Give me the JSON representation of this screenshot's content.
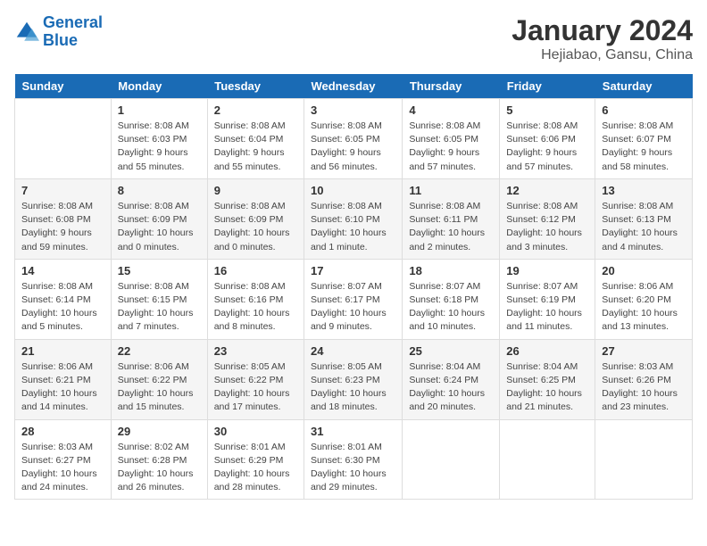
{
  "logo": {
    "line1": "General",
    "line2": "Blue"
  },
  "header": {
    "month": "January 2024",
    "location": "Hejiabao, Gansu, China"
  },
  "weekdays": [
    "Sunday",
    "Monday",
    "Tuesday",
    "Wednesday",
    "Thursday",
    "Friday",
    "Saturday"
  ],
  "weeks": [
    [
      null,
      {
        "day": 1,
        "sunrise": "8:08 AM",
        "sunset": "6:03 PM",
        "daylight": "9 hours and 55 minutes."
      },
      {
        "day": 2,
        "sunrise": "8:08 AM",
        "sunset": "6:04 PM",
        "daylight": "9 hours and 55 minutes."
      },
      {
        "day": 3,
        "sunrise": "8:08 AM",
        "sunset": "6:05 PM",
        "daylight": "9 hours and 56 minutes."
      },
      {
        "day": 4,
        "sunrise": "8:08 AM",
        "sunset": "6:05 PM",
        "daylight": "9 hours and 57 minutes."
      },
      {
        "day": 5,
        "sunrise": "8:08 AM",
        "sunset": "6:06 PM",
        "daylight": "9 hours and 57 minutes."
      },
      {
        "day": 6,
        "sunrise": "8:08 AM",
        "sunset": "6:07 PM",
        "daylight": "9 hours and 58 minutes."
      }
    ],
    [
      {
        "day": 7,
        "sunrise": "8:08 AM",
        "sunset": "6:08 PM",
        "daylight": "9 hours and 59 minutes."
      },
      {
        "day": 8,
        "sunrise": "8:08 AM",
        "sunset": "6:09 PM",
        "daylight": "10 hours and 0 minutes."
      },
      {
        "day": 9,
        "sunrise": "8:08 AM",
        "sunset": "6:09 PM",
        "daylight": "10 hours and 0 minutes."
      },
      {
        "day": 10,
        "sunrise": "8:08 AM",
        "sunset": "6:10 PM",
        "daylight": "10 hours and 1 minute."
      },
      {
        "day": 11,
        "sunrise": "8:08 AM",
        "sunset": "6:11 PM",
        "daylight": "10 hours and 2 minutes."
      },
      {
        "day": 12,
        "sunrise": "8:08 AM",
        "sunset": "6:12 PM",
        "daylight": "10 hours and 3 minutes."
      },
      {
        "day": 13,
        "sunrise": "8:08 AM",
        "sunset": "6:13 PM",
        "daylight": "10 hours and 4 minutes."
      }
    ],
    [
      {
        "day": 14,
        "sunrise": "8:08 AM",
        "sunset": "6:14 PM",
        "daylight": "10 hours and 5 minutes."
      },
      {
        "day": 15,
        "sunrise": "8:08 AM",
        "sunset": "6:15 PM",
        "daylight": "10 hours and 7 minutes."
      },
      {
        "day": 16,
        "sunrise": "8:08 AM",
        "sunset": "6:16 PM",
        "daylight": "10 hours and 8 minutes."
      },
      {
        "day": 17,
        "sunrise": "8:07 AM",
        "sunset": "6:17 PM",
        "daylight": "10 hours and 9 minutes."
      },
      {
        "day": 18,
        "sunrise": "8:07 AM",
        "sunset": "6:18 PM",
        "daylight": "10 hours and 10 minutes."
      },
      {
        "day": 19,
        "sunrise": "8:07 AM",
        "sunset": "6:19 PM",
        "daylight": "10 hours and 11 minutes."
      },
      {
        "day": 20,
        "sunrise": "8:06 AM",
        "sunset": "6:20 PM",
        "daylight": "10 hours and 13 minutes."
      }
    ],
    [
      {
        "day": 21,
        "sunrise": "8:06 AM",
        "sunset": "6:21 PM",
        "daylight": "10 hours and 14 minutes."
      },
      {
        "day": 22,
        "sunrise": "8:06 AM",
        "sunset": "6:22 PM",
        "daylight": "10 hours and 15 minutes."
      },
      {
        "day": 23,
        "sunrise": "8:05 AM",
        "sunset": "6:22 PM",
        "daylight": "10 hours and 17 minutes."
      },
      {
        "day": 24,
        "sunrise": "8:05 AM",
        "sunset": "6:23 PM",
        "daylight": "10 hours and 18 minutes."
      },
      {
        "day": 25,
        "sunrise": "8:04 AM",
        "sunset": "6:24 PM",
        "daylight": "10 hours and 20 minutes."
      },
      {
        "day": 26,
        "sunrise": "8:04 AM",
        "sunset": "6:25 PM",
        "daylight": "10 hours and 21 minutes."
      },
      {
        "day": 27,
        "sunrise": "8:03 AM",
        "sunset": "6:26 PM",
        "daylight": "10 hours and 23 minutes."
      }
    ],
    [
      {
        "day": 28,
        "sunrise": "8:03 AM",
        "sunset": "6:27 PM",
        "daylight": "10 hours and 24 minutes."
      },
      {
        "day": 29,
        "sunrise": "8:02 AM",
        "sunset": "6:28 PM",
        "daylight": "10 hours and 26 minutes."
      },
      {
        "day": 30,
        "sunrise": "8:01 AM",
        "sunset": "6:29 PM",
        "daylight": "10 hours and 28 minutes."
      },
      {
        "day": 31,
        "sunrise": "8:01 AM",
        "sunset": "6:30 PM",
        "daylight": "10 hours and 29 minutes."
      },
      null,
      null,
      null
    ]
  ]
}
